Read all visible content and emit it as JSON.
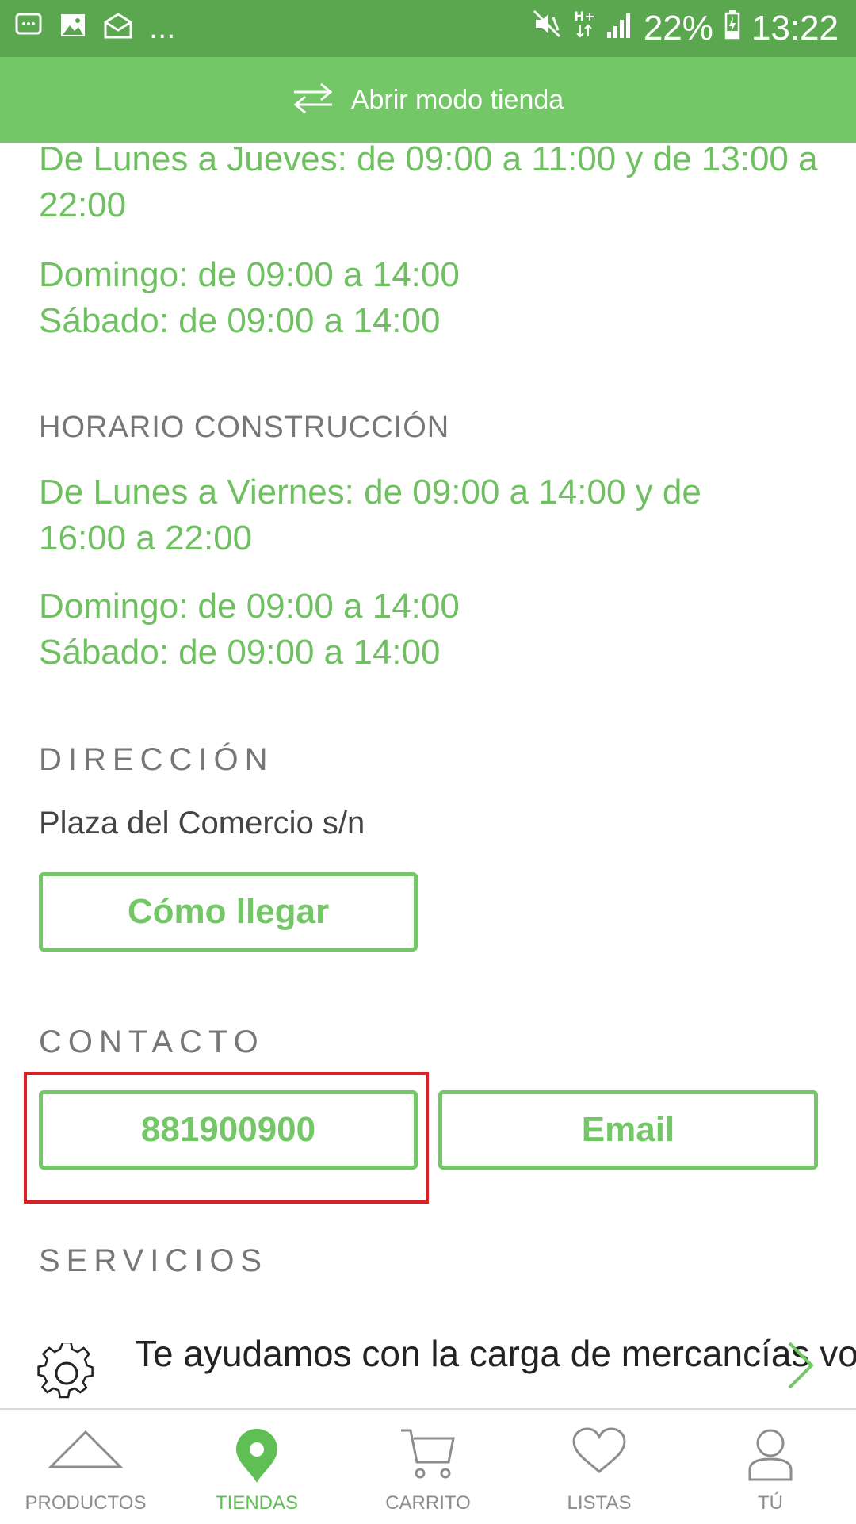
{
  "status": {
    "battery": "22%",
    "time": "13:22",
    "more": "..."
  },
  "topbar": {
    "label": "Abrir modo tienda"
  },
  "schedule": {
    "weekday": "De Lunes a Jueves: de 09:00 a 11:00 y de 13:00 a 22:00",
    "weekend": [
      "Domingo: de 09:00 a 14:00",
      "Sábado: de 09:00 a 14:00"
    ]
  },
  "construction": {
    "title": "HORARIO CONSTRUCCIÓN",
    "weekday": "De Lunes a Viernes: de 09:00 a 14:00 y de 16:00 a 22:00",
    "weekend": [
      "Domingo: de 09:00 a 14:00",
      "Sábado: de 09:00 a 14:00"
    ]
  },
  "address": {
    "title": "DIRECCIÓN",
    "text": "Plaza del Comercio s/n",
    "button": "Cómo llegar"
  },
  "contact": {
    "title": "CONTACTO",
    "phone": "881900900",
    "email": "Email"
  },
  "services": {
    "title": "SERVICIOS",
    "first": "Te ayudamos con la carga de mercancías voluminosas"
  },
  "bottom_nav": [
    "PRODUCTOS",
    "TIENDAS",
    "CARRITO",
    "LISTAS",
    "TÚ"
  ],
  "colors": {
    "primary": "#74c767",
    "statusbar": "#5aa74f",
    "highlight": "#e01e25"
  }
}
